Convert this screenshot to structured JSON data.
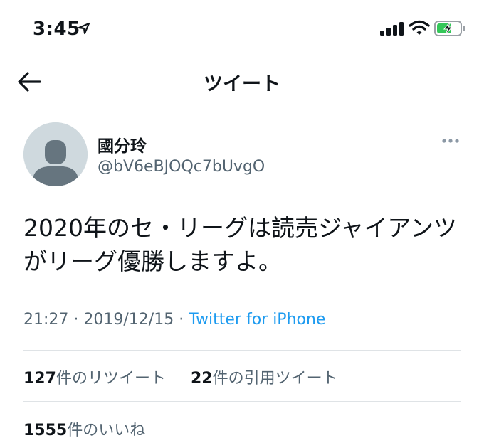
{
  "status_bar": {
    "time": "3:45"
  },
  "header": {
    "title": "ツイート"
  },
  "tweet": {
    "author_name": "國分玲",
    "author_handle": "@bV6eBJOQc7bUvgO",
    "text": "2020年のセ・リーグは読売ジャイアンツがリーグ優勝しますよ。",
    "time": "21:27",
    "date": "2019/12/15",
    "separator": "·",
    "source": "Twitter for iPhone"
  },
  "stats": {
    "retweets_count": "127",
    "retweets_label": "件のリツイート",
    "quotes_count": "22",
    "quotes_label": "件の引用ツイート",
    "likes_count": "1555",
    "likes_label": "件のいいね"
  },
  "colors": {
    "link": "#1d9bf0",
    "secondary_text": "#536471",
    "battery_green": "#34c759"
  },
  "icons": [
    "location-arrow-icon",
    "cellular-signal-icon",
    "wifi-icon",
    "battery-charging-icon",
    "back-arrow-icon",
    "more-options-icon",
    "default-avatar-icon"
  ]
}
